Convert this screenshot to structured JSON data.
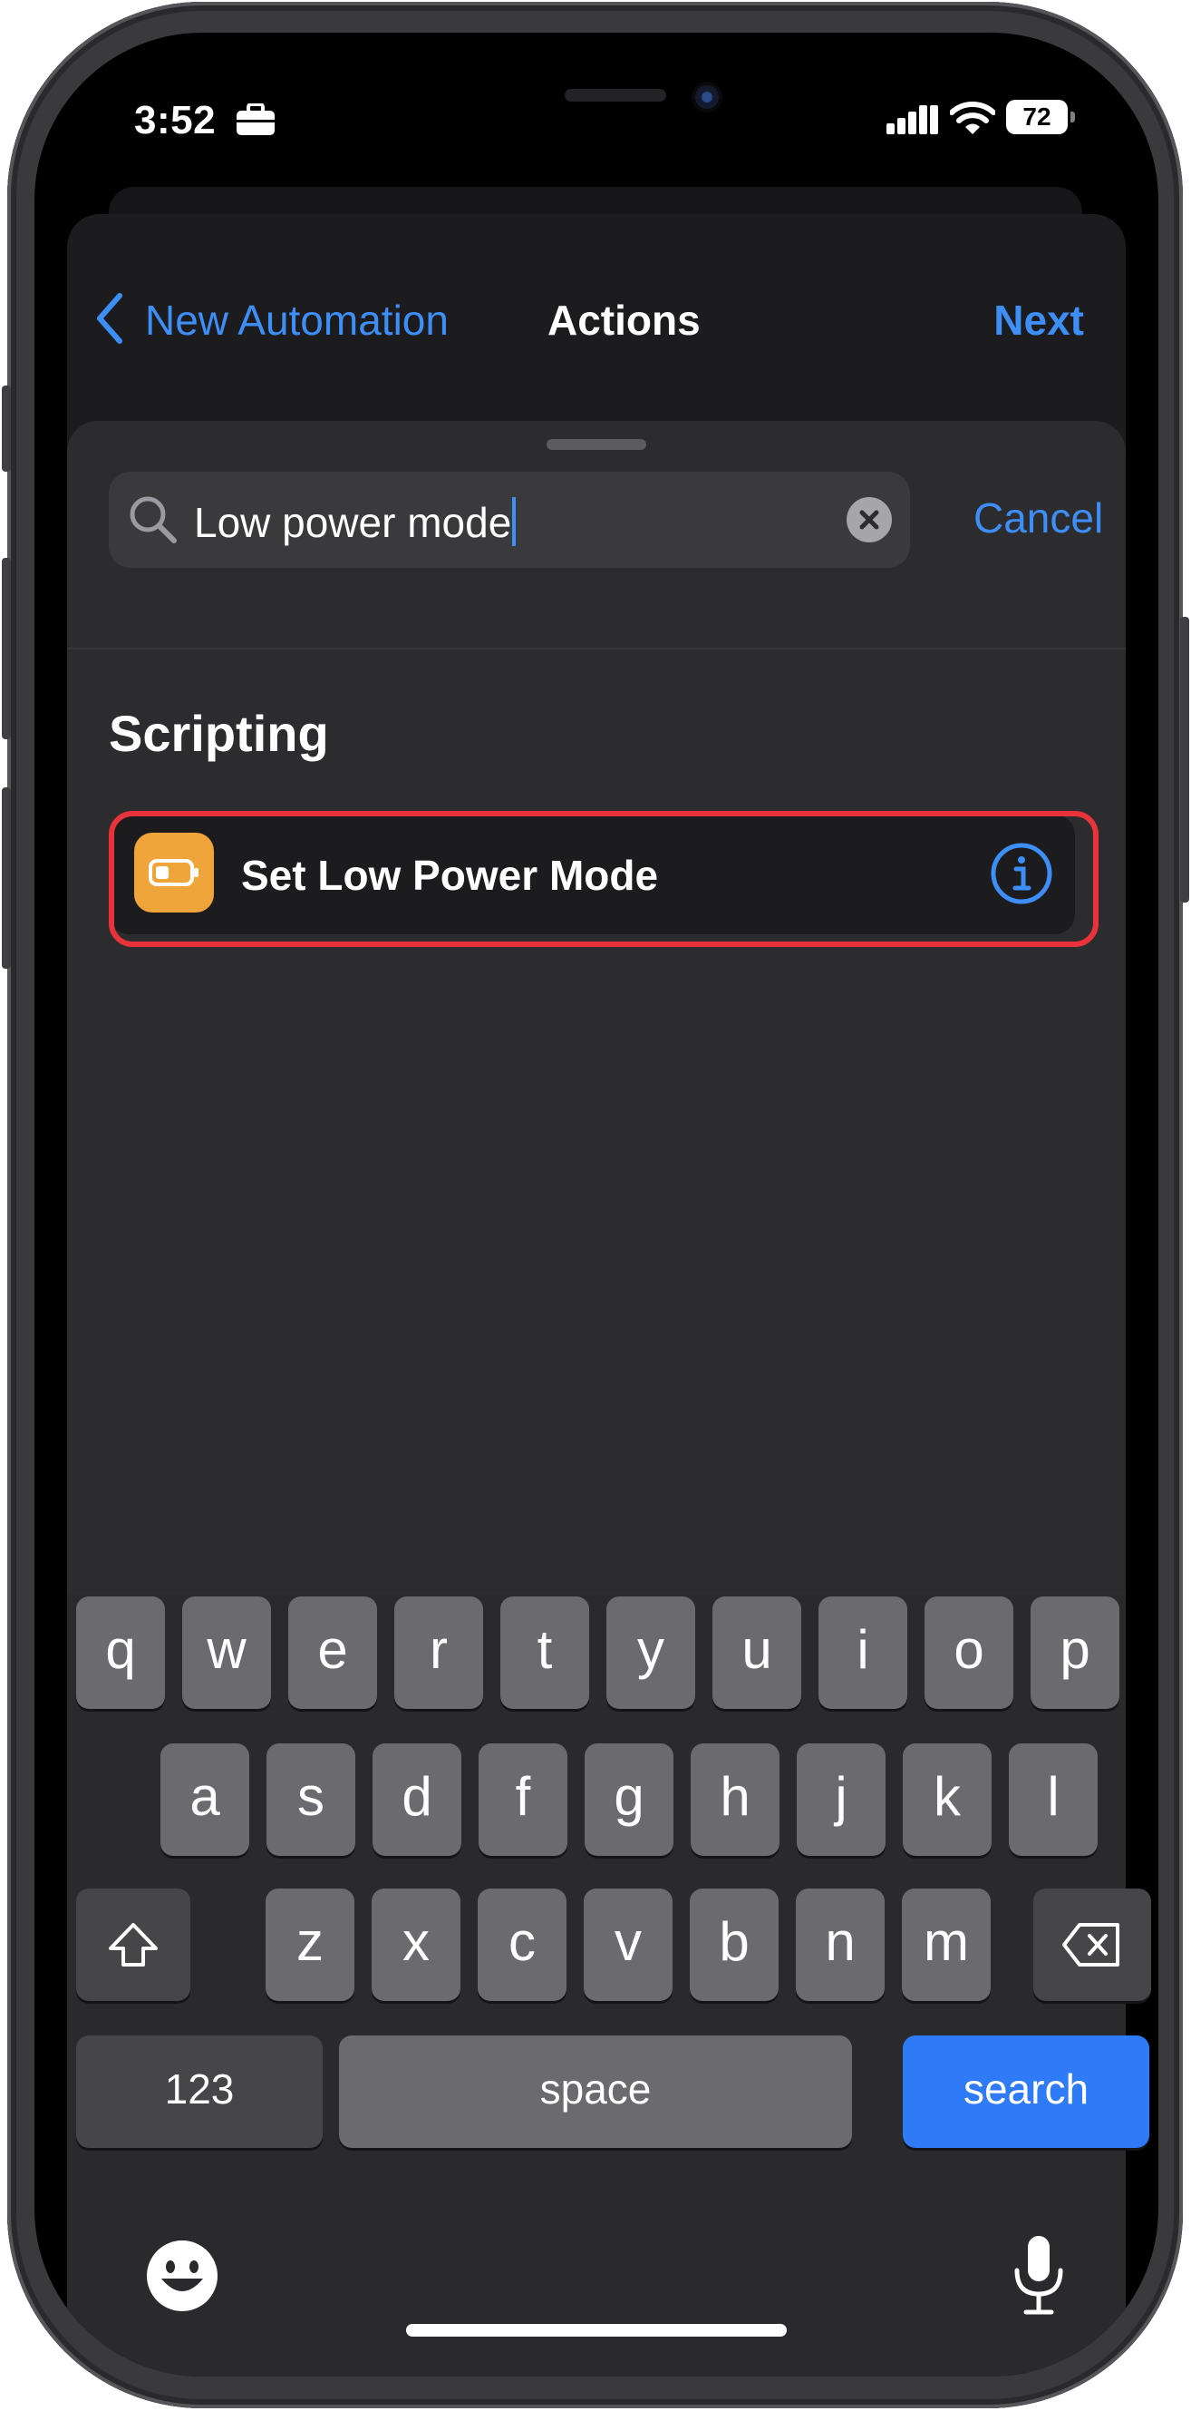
{
  "status_bar": {
    "time": "3:52",
    "focus_icon": "briefcase-icon",
    "signal_icon": "cellular-signal-icon",
    "wifi_icon": "wifi-icon",
    "battery_level": "72"
  },
  "nav": {
    "back_label": "New Automation",
    "title": "Actions",
    "next_label": "Next"
  },
  "search": {
    "value": "Low power mode",
    "cancel_label": "Cancel"
  },
  "results": {
    "section_title": "Scripting",
    "items": [
      {
        "label": "Set Low Power Mode",
        "icon": "battery-icon",
        "icon_color": "#f0a53a",
        "highlighted": true
      }
    ]
  },
  "keyboard": {
    "row1": [
      "q",
      "w",
      "e",
      "r",
      "t",
      "y",
      "u",
      "i",
      "o",
      "p"
    ],
    "row2": [
      "a",
      "s",
      "d",
      "f",
      "g",
      "h",
      "j",
      "k",
      "l"
    ],
    "row3": [
      "z",
      "x",
      "c",
      "v",
      "b",
      "n",
      "m"
    ],
    "numbers_label": "123",
    "space_label": "space",
    "search_label": "search"
  },
  "colors": {
    "accent": "#3e8ef7",
    "highlight_border": "#e8333a",
    "search_key": "#2f7af6"
  }
}
